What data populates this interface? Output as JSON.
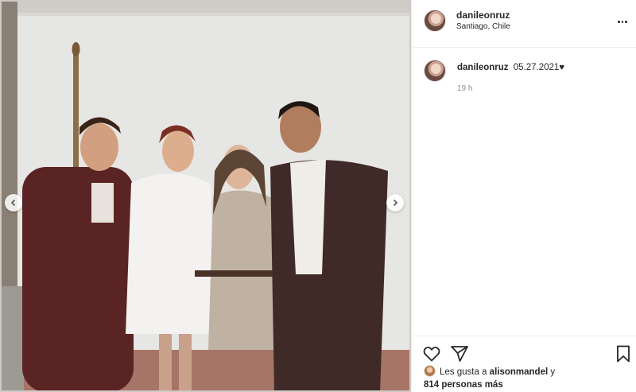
{
  "post": {
    "username": "danileonruz",
    "location": "Santiago, Chile",
    "caption_username": "danileonruz",
    "caption_text": "05.27.2021♥",
    "time": "19 h"
  },
  "likes": {
    "prefix": "Les gusta a",
    "user": "alisonmandel",
    "joiner": "y",
    "others": "814 personas más"
  },
  "icons": {
    "prev": "chevron-left-icon",
    "next": "chevron-right-icon",
    "like": "heart-icon",
    "share": "send-icon",
    "save": "bookmark-icon",
    "more": "more-icon"
  },
  "colors": {
    "text": "#262626",
    "muted": "#8e8e8e",
    "border": "#efefef"
  }
}
